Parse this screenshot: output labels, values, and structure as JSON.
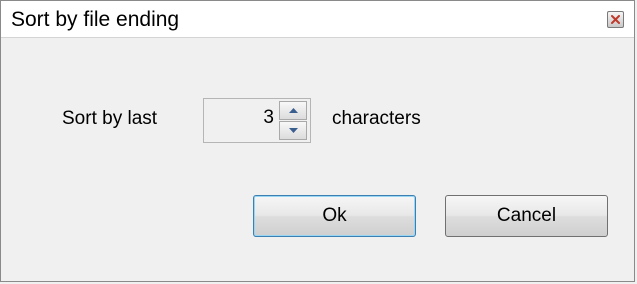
{
  "window": {
    "title": "Sort by file ending",
    "close_icon": "close-icon"
  },
  "form": {
    "label_prefix": "Sort by last",
    "spinner_value": "3",
    "label_suffix": "characters",
    "spin_up_icon": "arrow-up-icon",
    "spin_down_icon": "arrow-down-icon"
  },
  "buttons": {
    "ok_label": "Ok",
    "cancel_label": "Cancel"
  },
  "colors": {
    "default_button_border": "#3c7fb1",
    "close_button_glyph": "#c0392b"
  }
}
